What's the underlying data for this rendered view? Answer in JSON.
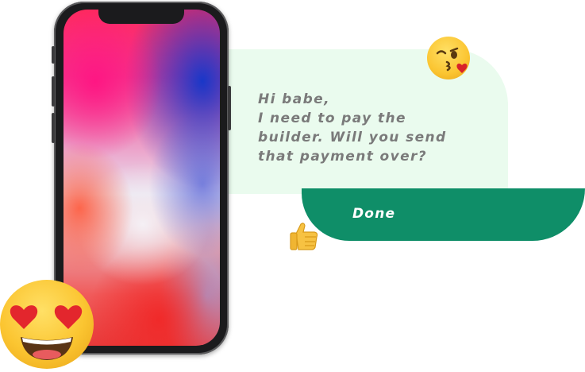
{
  "messages": {
    "incoming": {
      "lines": [
        "Hi babe,",
        "I need to pay the",
        "builder. Will you send",
        "that payment over?"
      ]
    },
    "outgoing": {
      "text": "Done"
    }
  },
  "icons": {
    "phone": "smartphone-mockup",
    "emoji_large": "heart-eyes-emoji",
    "emoji_kiss": "kissing-face-emoji",
    "emoji_thumb": "thumbs-up-emoji"
  },
  "colors": {
    "incoming_bubble": "#eafbee",
    "incoming_text": "#7a7a7a",
    "outgoing_bubble": "#0f8e68",
    "outgoing_text": "#ffffff"
  }
}
